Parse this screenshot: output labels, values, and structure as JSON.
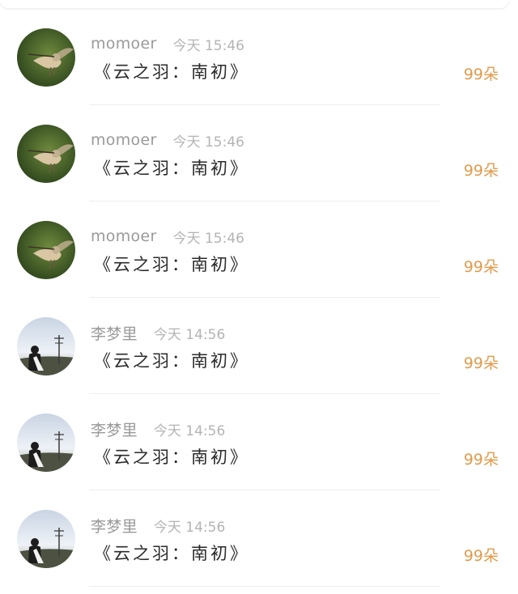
{
  "comments": [
    {
      "avatar": "hummingbird-avatar",
      "username": "momoer",
      "time": "今天 15:46",
      "gift": "《云之羽：南初》",
      "count": "99朵"
    },
    {
      "avatar": "hummingbird-avatar",
      "username": "momoer",
      "time": "今天 15:46",
      "gift": "《云之羽：南初》",
      "count": "99朵"
    },
    {
      "avatar": "hummingbird-avatar",
      "username": "momoer",
      "time": "今天 15:46",
      "gift": "《云之羽：南初》",
      "count": "99朵"
    },
    {
      "avatar": "girl-landscape-avatar",
      "username": "李梦里",
      "time": "今天 14:56",
      "gift": "《云之羽：南初》",
      "count": "99朵"
    },
    {
      "avatar": "girl-landscape-avatar",
      "username": "李梦里",
      "time": "今天 14:56",
      "gift": "《云之羽：南初》",
      "count": "99朵"
    },
    {
      "avatar": "girl-landscape-avatar",
      "username": "李梦里",
      "time": "今天 14:56",
      "gift": "《云之羽：南初》",
      "count": "99朵"
    }
  ],
  "colors": {
    "username": "#9a9a9a",
    "time": "#b4b4b4",
    "title": "#2a2a2a",
    "count": "#e29a4a"
  }
}
